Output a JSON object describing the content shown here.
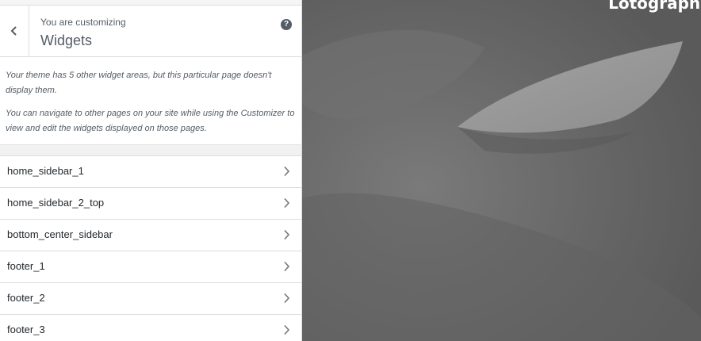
{
  "header": {
    "kicker": "You are customizing",
    "title": "Widgets",
    "help_icon_glyph": "?",
    "back_icon": "chevron-left-icon"
  },
  "notice": {
    "paragraph_1": "Your theme has 5 other widget areas, but this particular page doesn't display them.",
    "paragraph_2": "You can navigate to other pages on your site while using the Customizer to view and edit the widgets displayed on those pages."
  },
  "sections": [
    {
      "label": "home_sidebar_1"
    },
    {
      "label": "home_sidebar_2_top"
    },
    {
      "label": "bottom_center_sidebar"
    },
    {
      "label": "footer_1"
    },
    {
      "label": "footer_2"
    },
    {
      "label": "footer_3"
    }
  ],
  "preview": {
    "brand_text": "Lotographi"
  },
  "colors": {
    "panel_bg": "#f1f1f1",
    "text": "#555d66",
    "item_text": "#23282d",
    "preview_bg": "#6d6d6d"
  }
}
